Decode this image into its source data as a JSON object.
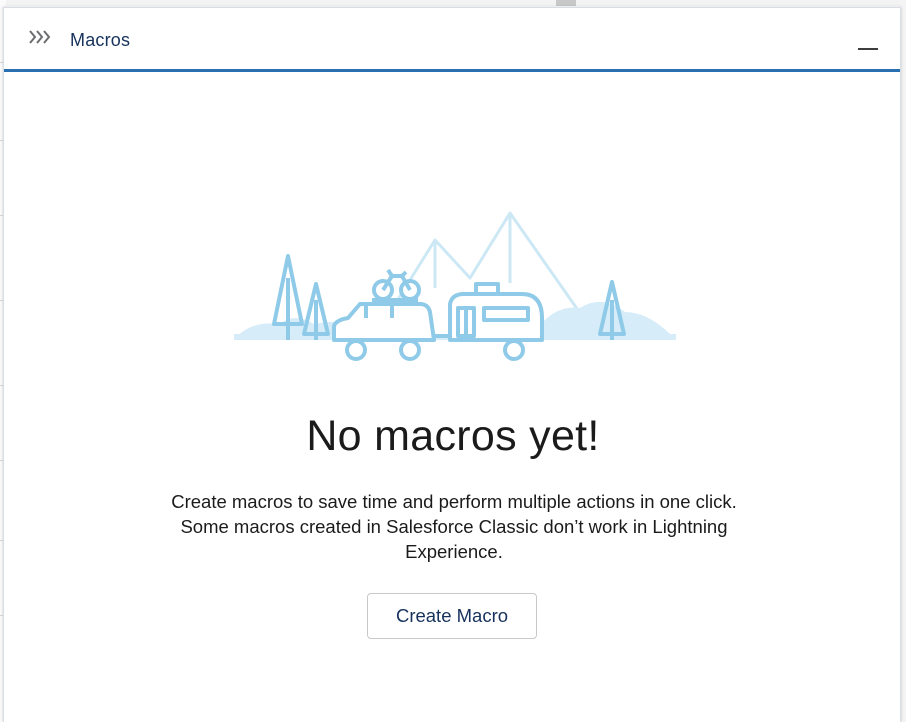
{
  "panel": {
    "title": "Macros",
    "header_icon": "chevrons-right-icon",
    "minimize_icon": "minimize-icon",
    "accent_color": "#2a6fb0"
  },
  "empty_state": {
    "illustration": "camping-trip-illustration",
    "title": "No macros yet!",
    "description": "Create macros to save time and perform multiple actions in one click. Some macros created in Salesforce Classic don’t work in Lightning Experience.",
    "illustration_color": "#8fcbe8"
  },
  "actions": {
    "create_macro_label": "Create Macro"
  }
}
